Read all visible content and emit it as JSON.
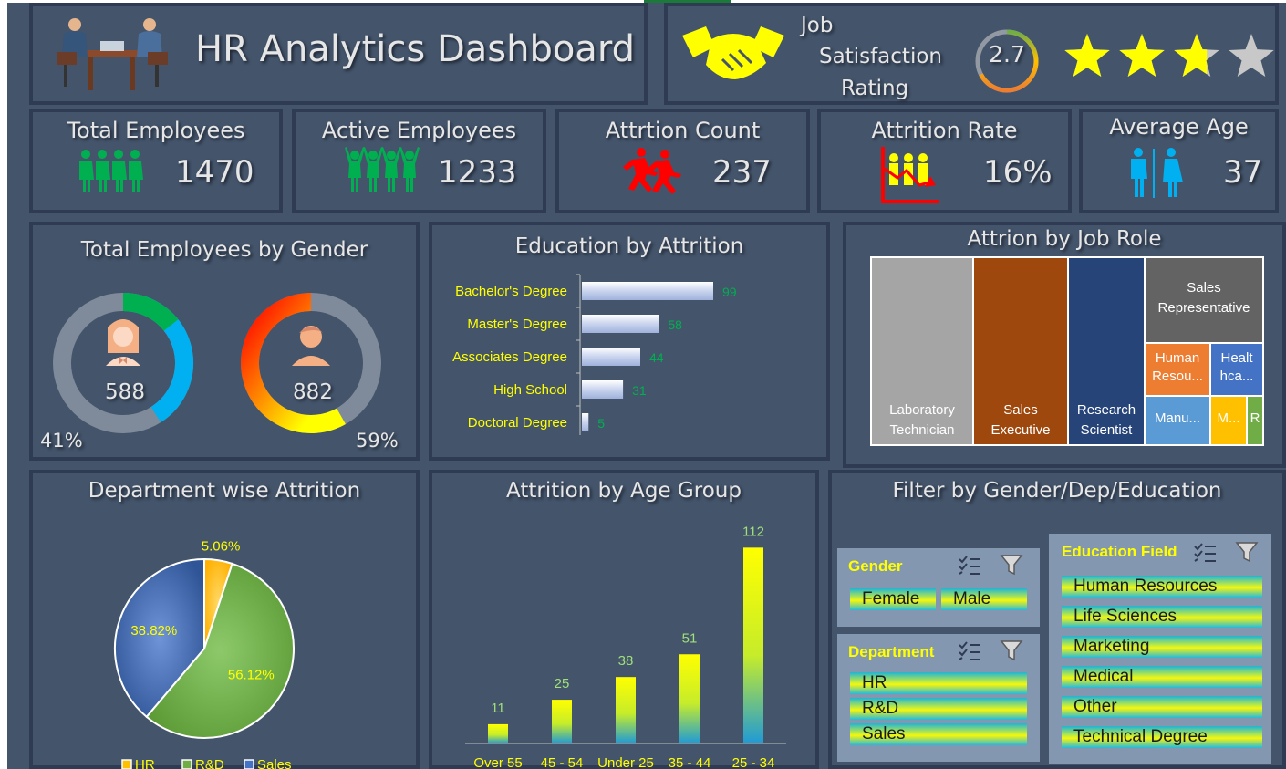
{
  "header": {
    "title": "HR Analytics Dashboard"
  },
  "satisfaction": {
    "label_line1": "Job",
    "label_line2": "Satisfaction",
    "label_line3": "Rating",
    "value": "2.7",
    "rating": 2.7,
    "max": 4
  },
  "kpis": [
    {
      "title": "Total Employees",
      "value": "1470",
      "icon": "people-group-icon",
      "color": "#00b050"
    },
    {
      "title": "Active Employees",
      "value": "1233",
      "icon": "people-cheering-icon",
      "color": "#00b050"
    },
    {
      "title": "Attrtion Count",
      "value": "237",
      "icon": "running-people-icon",
      "color": "#ff0000"
    },
    {
      "title": "Attrition Rate",
      "value": "16%",
      "icon": "declining-chart-people-icon",
      "color": "#ffff00"
    },
    {
      "title": "Average Age",
      "value": "37",
      "icon": "restroom-people-icon",
      "color": "#00b0f0"
    }
  ],
  "gender": {
    "title": "Total Employees by Gender",
    "female": {
      "count": "588",
      "pct": "41%",
      "share": 0.41,
      "icon": "female-avatar-icon"
    },
    "male": {
      "count": "882",
      "pct": "59%",
      "share": 0.59,
      "icon": "male-avatar-icon"
    }
  },
  "education": {
    "title": "Education by Attrition",
    "categories": [
      "Bachelor's Degree",
      "Master's Degree",
      "Associates Degree",
      "High School",
      "Doctoral Degree"
    ],
    "values": [
      99,
      58,
      44,
      31,
      5
    ]
  },
  "jobrole": {
    "title": "Attrion by Job Role",
    "tiles": [
      {
        "label": "Laboratory Technician",
        "line1": "Laboratory",
        "line2": "Technician",
        "color": "#a5a5a5"
      },
      {
        "label": "Sales Executive",
        "line1": "Sales",
        "line2": "Executive",
        "color": "#9e480e"
      },
      {
        "label": "Research Scientist",
        "line1": "Research",
        "line2": "Scientist",
        "color": "#264478"
      },
      {
        "label": "Sales Representative",
        "line1": "Sales",
        "line2": "Representative",
        "color": "#636363"
      },
      {
        "label": "Human Resou...",
        "line1": "Human",
        "line2": "Resou...",
        "color": "#ed7d31"
      },
      {
        "label": "Healt hca...",
        "line1": "Healt",
        "line2": "hca...",
        "color": "#4472c4"
      },
      {
        "label": "Manu...",
        "line1": "Manu...",
        "line2": "",
        "color": "#5b9bd5"
      },
      {
        "label": "M...",
        "line1": "M...",
        "line2": "",
        "color": "#ffc000"
      },
      {
        "label": "R",
        "line1": "R",
        "line2": "",
        "color": "#70ad47"
      }
    ]
  },
  "chart_data": [
    {
      "type": "pie",
      "title": "Department wise Attrition",
      "categories": [
        "HR",
        "R&D",
        "Sales"
      ],
      "values": [
        5.06,
        56.12,
        38.82
      ],
      "labels": [
        "5.06%",
        "56.12%",
        "38.82%"
      ],
      "colors": [
        "#ffc000",
        "#70ad47",
        "#4472c4"
      ],
      "legend": "bottom"
    },
    {
      "type": "bar",
      "title": "Attrition by Age Group",
      "categories": [
        "Over 55",
        "45 - 54",
        "Under 25",
        "35 - 44",
        "25 - 34"
      ],
      "values": [
        11,
        25,
        38,
        51,
        112
      ],
      "ylim": [
        0,
        120
      ]
    },
    {
      "type": "bar",
      "title": "Education by Attrition",
      "orientation": "horizontal",
      "categories": [
        "Bachelor's Degree",
        "Master's Degree",
        "Associates Degree",
        "High School",
        "Doctoral Degree"
      ],
      "values": [
        99,
        58,
        44,
        31,
        5
      ]
    }
  ],
  "filter": {
    "title": "Filter by Gender/Dep/Education",
    "gender": {
      "header": "Gender",
      "items": [
        "Female",
        "Male"
      ]
    },
    "department": {
      "header": "Department",
      "items": [
        "HR",
        "R&D",
        "Sales"
      ]
    },
    "education_field": {
      "header": "Education Field",
      "items": [
        "Human Resources",
        "Life Sciences",
        "Marketing",
        "Medical",
        "Other",
        "Technical Degree"
      ]
    }
  },
  "colors": {
    "background": "#44546a",
    "border": "#2f3b52",
    "accent_yellow": "#ffff00",
    "value_green": "#00b050"
  }
}
